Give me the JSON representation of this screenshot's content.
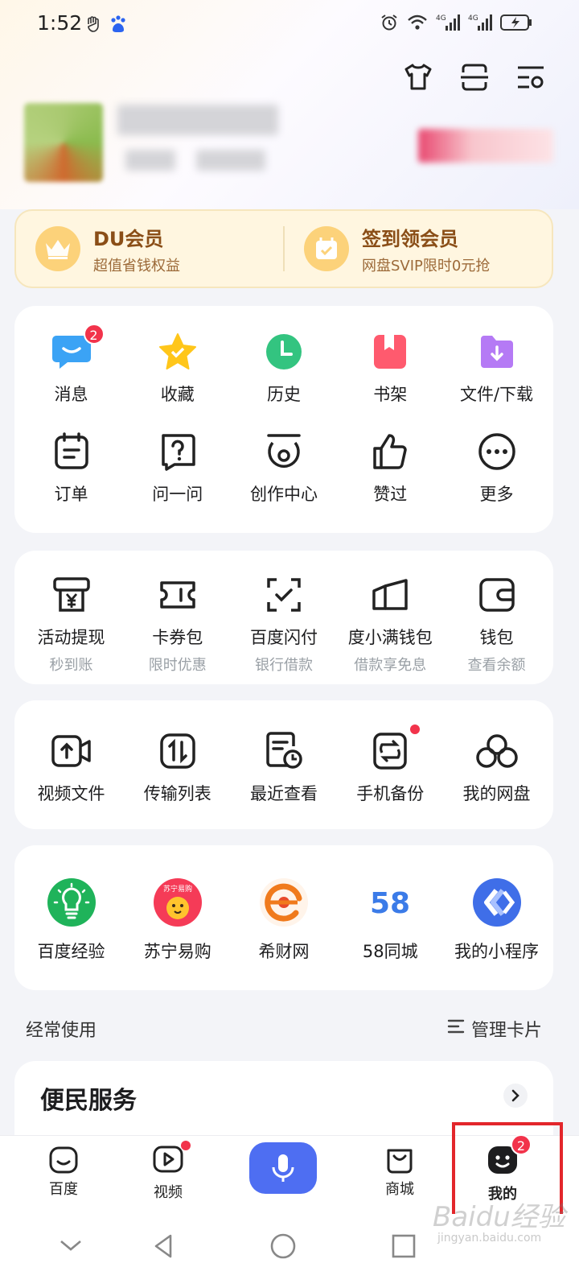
{
  "status_bar": {
    "time": "1:52"
  },
  "member": {
    "left_title": "DU会员",
    "left_sub": "超值省钱权益",
    "right_title": "签到领会员",
    "right_sub": "网盘SVIP限时0元抢"
  },
  "quick": {
    "row1": [
      {
        "label": "消息",
        "badge": "2"
      },
      {
        "label": "收藏"
      },
      {
        "label": "历史"
      },
      {
        "label": "书架"
      },
      {
        "label": "文件/下载"
      }
    ],
    "row2": [
      {
        "label": "订单"
      },
      {
        "label": "问一问"
      },
      {
        "label": "创作中心"
      },
      {
        "label": "赞过"
      },
      {
        "label": "更多"
      }
    ]
  },
  "finance": [
    {
      "label": "活动提现",
      "sub": "秒到账"
    },
    {
      "label": "卡券包",
      "sub": "限时优惠"
    },
    {
      "label": "百度闪付",
      "sub": "银行借款"
    },
    {
      "label": "度小满钱包",
      "sub": "借款享免息"
    },
    {
      "label": "钱包",
      "sub": "查看余额"
    }
  ],
  "netdisk": [
    {
      "label": "视频文件"
    },
    {
      "label": "传输列表"
    },
    {
      "label": "最近查看"
    },
    {
      "label": "手机备份"
    },
    {
      "label": "我的网盘"
    }
  ],
  "apps": [
    {
      "label": "百度经验"
    },
    {
      "label": "苏宁易购",
      "logo_text": "苏宁易购"
    },
    {
      "label": "希财网"
    },
    {
      "label": "58同城",
      "logo_text": "58"
    },
    {
      "label": "我的小程序"
    }
  ],
  "frequent": {
    "title": "经常使用",
    "manage": "管理卡片"
  },
  "service": {
    "title": "便民服务"
  },
  "bottom_nav": {
    "home": "百度",
    "video": "视频",
    "mall": "商城",
    "mine": "我的",
    "mine_badge": "2"
  },
  "watermark": {
    "text": "Baidu经验",
    "sub": "jingyan.baidu.com"
  },
  "colors": {
    "accent": "#4e6ef2",
    "badge": "#f2334b",
    "highlight": "#e3262b"
  }
}
